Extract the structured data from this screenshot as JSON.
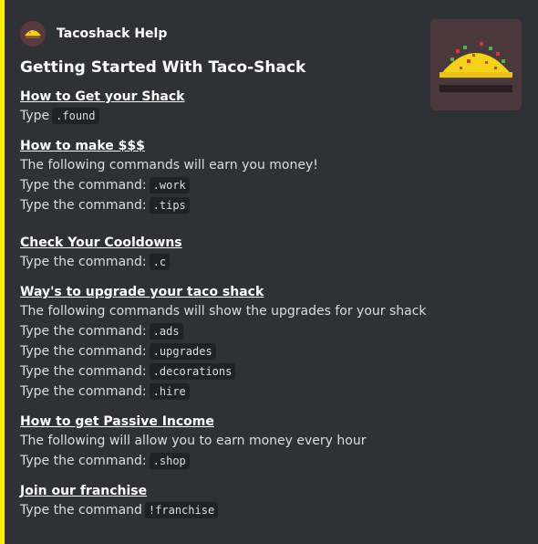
{
  "embed": {
    "accent_color": "#fff200",
    "author": {
      "name": "Tacoshack Help",
      "icon": "taco-icon"
    },
    "title": "Getting Started With Taco-Shack",
    "thumbnail": {
      "icon": "taco-icon"
    }
  },
  "sections": [
    {
      "title": "How to Get your Shack",
      "lines": [
        {
          "text": "Type",
          "code": ".found"
        }
      ]
    },
    {
      "title": "How to make $$$",
      "lines": [
        {
          "text": "The following commands will earn you money!",
          "code": null
        },
        {
          "text": "Type the command:",
          "code": ".work"
        },
        {
          "text": "Type the command:",
          "code": ".tips"
        }
      ]
    },
    {
      "title": "Check Your Cooldowns",
      "lines": [
        {
          "text": "Type the command:",
          "code": ".c"
        }
      ]
    },
    {
      "title": "Way's to upgrade your taco shack",
      "lines": [
        {
          "text": "The following commands will show the upgrades for your shack",
          "code": null
        },
        {
          "text": "Type the command:",
          "code": ".ads"
        },
        {
          "text": "Type the command:",
          "code": ".upgrades"
        },
        {
          "text": "Type the command:",
          "code": ".decorations"
        },
        {
          "text": "Type the command:",
          "code": ".hire"
        }
      ]
    },
    {
      "title": "How to get Passive Income",
      "lines": [
        {
          "text": "The following will allow you to earn money every hour",
          "code": null
        },
        {
          "text": "Type the command:",
          "code": ".shop"
        }
      ]
    },
    {
      "title": "Join our franchise",
      "lines": [
        {
          "text": "Type the command",
          "code": "!franchise"
        }
      ]
    }
  ]
}
